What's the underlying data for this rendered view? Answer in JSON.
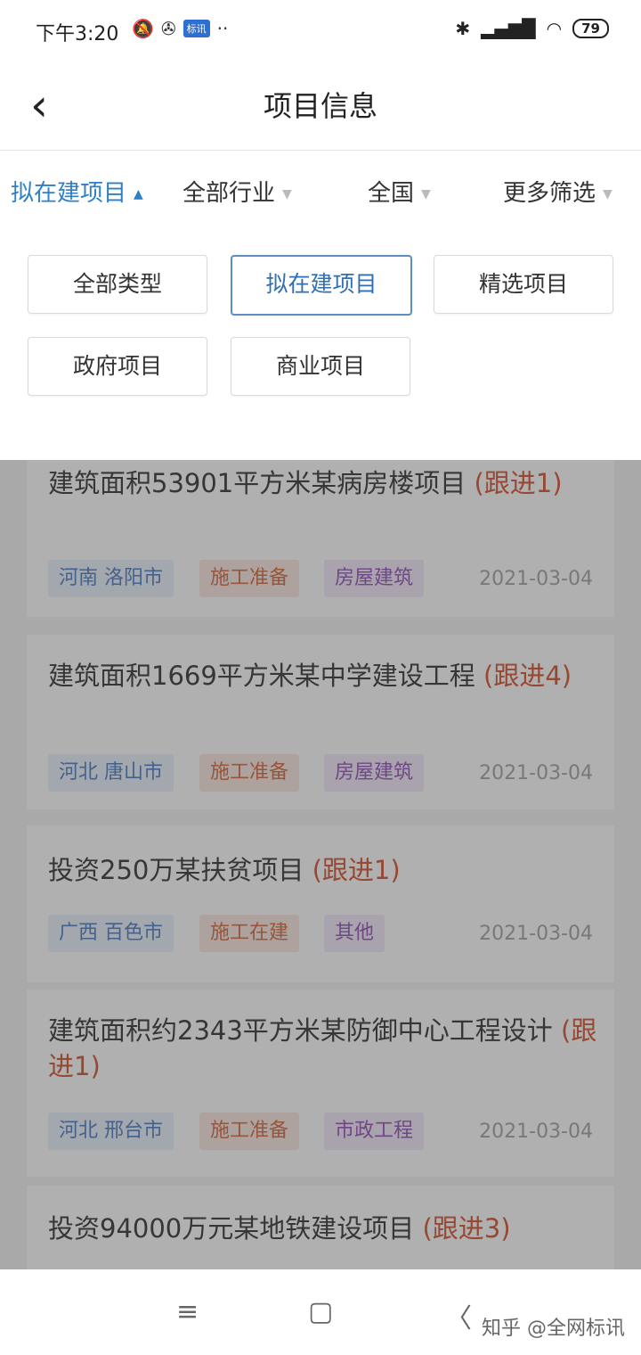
{
  "status_bar": {
    "time": "下午3:20",
    "left_icons": [
      "mute-icon",
      "pinwheel-icon",
      "app-badge-icon",
      "more-dots-icon"
    ],
    "app_badge": "标讯",
    "battery": "79"
  },
  "header": {
    "title": "项目信息"
  },
  "filters": [
    {
      "label": "拟在建项目",
      "active": true
    },
    {
      "label": "全部行业",
      "active": false
    },
    {
      "label": "全国",
      "active": false
    },
    {
      "label": "更多筛选",
      "active": false
    }
  ],
  "dropdown": {
    "options": [
      "全部类型",
      "拟在建项目",
      "精选项目",
      "政府项目",
      "商业项目"
    ],
    "selected": "拟在建项目"
  },
  "projects": [
    {
      "title": "建筑面积53901平方米某病房楼项目",
      "follow": "(跟进1)",
      "region": "河南 洛阳市",
      "stage": "施工准备",
      "type": "房屋建筑",
      "date": "2021-03-04"
    },
    {
      "title": "建筑面积1669平方米某中学建设工程",
      "follow": "(跟进4)",
      "region": "河北 唐山市",
      "stage": "施工准备",
      "type": "房屋建筑",
      "date": "2021-03-04"
    },
    {
      "title": "投资250万某扶贫项目",
      "follow": "(跟进1)",
      "region": "广西 百色市",
      "stage": "施工在建",
      "type": "其他",
      "date": "2021-03-04"
    },
    {
      "title": "建筑面积约2343平方米某防御中心工程设计",
      "follow": "(跟进1)",
      "region": "河北 邢台市",
      "stage": "施工准备",
      "type": "市政工程",
      "date": "2021-03-04"
    },
    {
      "title": "投资94000万元某地铁建设项目",
      "follow": "(跟进3)"
    }
  ],
  "navbar": {
    "menu_icon": "≡",
    "home_icon": "▢",
    "back_icon": "〈",
    "watermark": "知乎 @全网标讯"
  }
}
